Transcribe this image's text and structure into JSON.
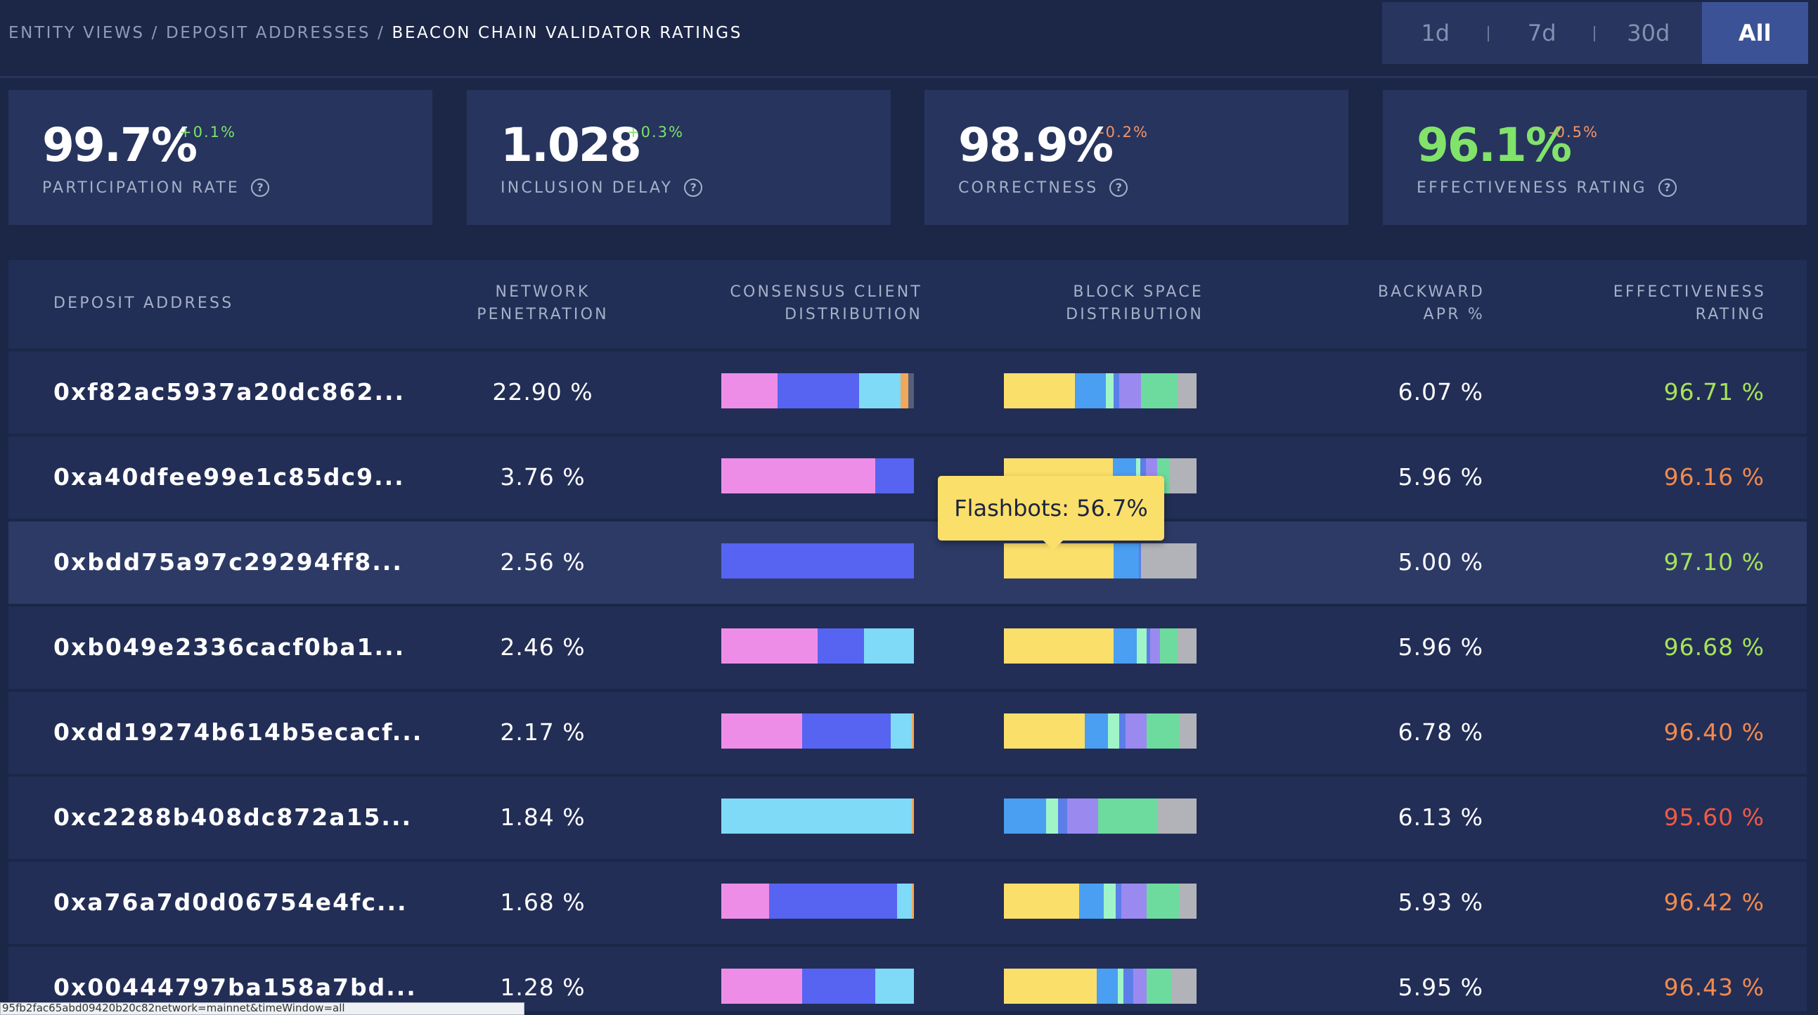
{
  "breadcrumb": [
    "ENTITY VIEWS",
    "DEPOSIT ADDRESSES",
    "BEACON CHAIN VALIDATOR RATINGS"
  ],
  "breadcrumb_separator": "/",
  "time_filter": {
    "options": [
      "1d",
      "7d",
      "30d",
      "All"
    ],
    "selected": "All"
  },
  "metrics": [
    {
      "value": "99.7%",
      "delta": "+0.1%",
      "label": "PARTICIPATION RATE",
      "help_icon": "question-circle-icon"
    },
    {
      "value": "1.028",
      "delta": "+0.3%",
      "label": "INCLUSION DELAY",
      "help_icon": "question-circle-icon"
    },
    {
      "value": "98.9%",
      "delta": "-0.2%",
      "label": "CORRECTNESS",
      "help_icon": "question-circle-icon"
    },
    {
      "value": "96.1%",
      "delta": "-0.5%",
      "label": "EFFECTIVENESS RATING",
      "help_icon": "question-circle-icon"
    }
  ],
  "help_glyph": "?",
  "table": {
    "columns": [
      [
        "DEPOSIT ADDRESS"
      ],
      [
        "NETWORK",
        "PENETRATION"
      ],
      [
        "CONSENSUS CLIENT",
        "DISTRIBUTION"
      ],
      [
        "BLOCK SPACE",
        "DISTRIBUTION"
      ],
      [
        "BACKWARD",
        "APR %"
      ],
      [
        "EFFECTIVENESS",
        "RATING"
      ]
    ],
    "rows": [
      {
        "address": "0xf82ac5937a20dc862...",
        "penetration": "22.90 %",
        "apr": "6.07 %",
        "rating": "96.71 %",
        "consensus": [
          0.29,
          0.42,
          0.21,
          0.04,
          0.03
        ],
        "blockspace": [
          0.37,
          0.16,
          0.04,
          0.03,
          0.11,
          0.19,
          0.1
        ]
      },
      {
        "address": "0xa40dfee99e1c85dc9...",
        "penetration": "3.76 %",
        "apr": "5.96 %",
        "rating": "96.16 %",
        "consensus": [
          0.8,
          0.2,
          0,
          0,
          0
        ],
        "blockspace": [
          0.567,
          0.12,
          0.02,
          0.03,
          0.06,
          0.06,
          0.143
        ]
      },
      {
        "address": "0xbdd75a97c29294ff8...",
        "penetration": "2.56 %",
        "apr": "5.00 %",
        "rating": "97.10 %",
        "consensus": [
          0,
          1.0,
          0,
          0,
          0
        ],
        "blockspace": [
          0.57,
          0.13,
          0,
          0.01,
          0,
          0,
          0.29
        ]
      },
      {
        "address": "0xb049e2336cacf0ba1...",
        "penetration": "2.46 %",
        "apr": "5.96 %",
        "rating": "96.68 %",
        "consensus": [
          0.5,
          0.24,
          0.26,
          0,
          0
        ],
        "blockspace": [
          0.57,
          0.12,
          0.05,
          0.02,
          0.05,
          0.09,
          0.1
        ]
      },
      {
        "address": "0xdd19274b614b5ecacf...",
        "penetration": "2.17 %",
        "apr": "6.78 %",
        "rating": "96.40 %",
        "consensus": [
          0.42,
          0.46,
          0.11,
          0.01,
          0
        ],
        "blockspace": [
          0.42,
          0.12,
          0.06,
          0.03,
          0.11,
          0.17,
          0.09
        ]
      },
      {
        "address": "0xc2288b408dc872a15...",
        "penetration": "1.84 %",
        "apr": "6.13 %",
        "rating": "95.60 %",
        "consensus": [
          0,
          0,
          0.99,
          0.01,
          0
        ],
        "blockspace": [
          0,
          0.22,
          0.06,
          0.05,
          0.16,
          0.31,
          0.2
        ]
      },
      {
        "address": "0xa76a7d0d06754e4fc...",
        "penetration": "1.68 %",
        "apr": "5.93 %",
        "rating": "96.42 %",
        "consensus": [
          0.25,
          0.67,
          0.08,
          0.01,
          0
        ],
        "blockspace": [
          0.39,
          0.13,
          0.06,
          0.03,
          0.13,
          0.17,
          0.09
        ]
      },
      {
        "address": "0x00444797ba158a7bd...",
        "penetration": "1.28 %",
        "apr": "5.95 %",
        "rating": "96.43 %",
        "consensus": [
          0.42,
          0.38,
          0.2,
          0,
          0
        ],
        "blockspace": [
          0.48,
          0.11,
          0.03,
          0.05,
          0.07,
          0.13,
          0.13
        ]
      }
    ],
    "highlighted_row": 2
  },
  "tooltip": {
    "text": "Flashbots: 56.7%"
  },
  "status_url": "95fb2fac65abd09420b20c82network=mainnet&timeWindow=all",
  "colors": {
    "background": "#1c2748",
    "card": "#27345e",
    "row": "#222e56",
    "highlight_row": "#2d3a66",
    "filter_active": "#3c5296",
    "delta_positive": "#7be36a",
    "delta_negative": "#f59565",
    "rating_green": "#a7e35a",
    "rating_orange": "#f28a4d",
    "rating_red": "#ef5b45",
    "consensus_segments": [
      "#ee8de7",
      "#5664f1",
      "#7fdaf7",
      "#f0a85c",
      "#565e7a"
    ],
    "blockspace_segments": [
      "#fbdf6b",
      "#4a9ff2",
      "#9ff5c8",
      "#5b7ee8",
      "#9a8af0",
      "#6ddb9e",
      "#b2b3b9"
    ]
  },
  "icons": {
    "help": "question-circle-icon"
  }
}
